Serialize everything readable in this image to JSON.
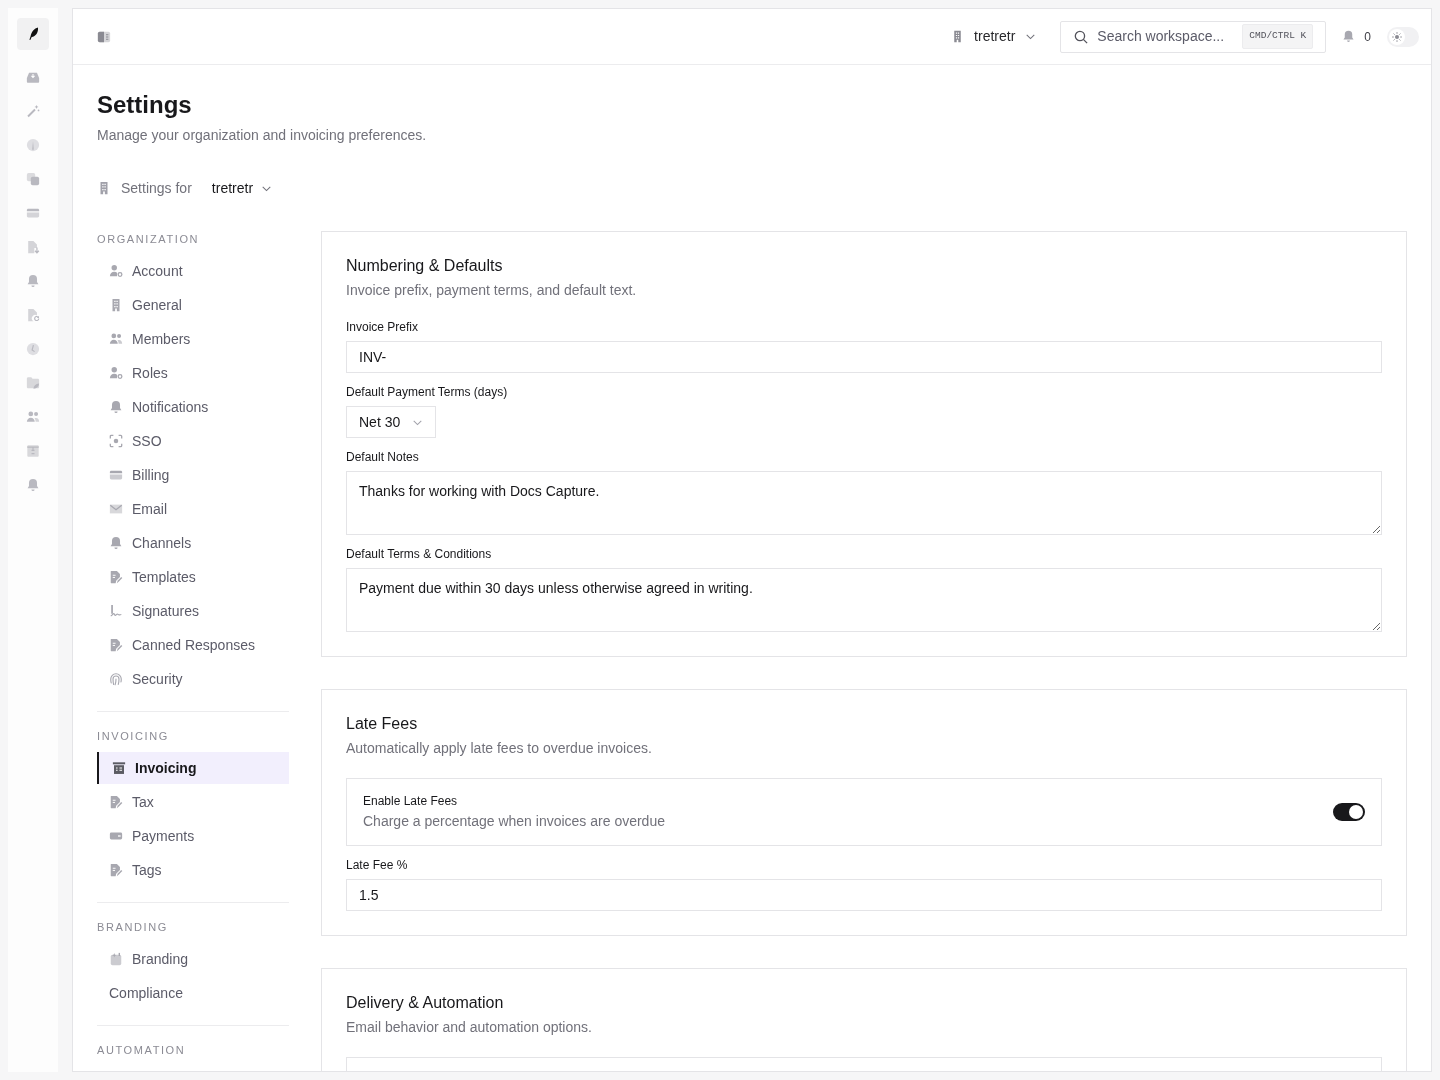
{
  "topbar": {
    "workspace": "tretretr",
    "search": {
      "placeholder": "Search workspace...",
      "shortcut": "CMD/CTRL K"
    },
    "notifications": {
      "count": "0"
    },
    "theme_switch": {
      "on": false
    }
  },
  "page": {
    "title": "Settings",
    "subtitle": "Manage your organization and invoicing preferences.",
    "scope": {
      "label": "Settings for",
      "value": "tretretr"
    }
  },
  "nav": [
    {
      "heading": "ORGANIZATION",
      "items": [
        {
          "label": "Account",
          "selected": false
        },
        {
          "label": "General",
          "selected": false
        },
        {
          "label": "Members",
          "selected": false
        },
        {
          "label": "Roles",
          "selected": false
        },
        {
          "label": "Notifications",
          "selected": false
        },
        {
          "label": "SSO",
          "selected": false
        },
        {
          "label": "Billing",
          "selected": false
        },
        {
          "label": "Email",
          "selected": false
        },
        {
          "label": "Channels",
          "selected": false
        },
        {
          "label": "Templates",
          "selected": false
        },
        {
          "label": "Signatures",
          "selected": false
        },
        {
          "label": "Canned Responses",
          "selected": false
        },
        {
          "label": "Security",
          "selected": false
        }
      ]
    },
    {
      "heading": "INVOICING",
      "items": [
        {
          "label": "Invoicing",
          "selected": true
        },
        {
          "label": "Tax",
          "selected": false
        },
        {
          "label": "Payments",
          "selected": false
        },
        {
          "label": "Tags",
          "selected": false
        }
      ]
    },
    {
      "heading": "BRANDING",
      "items": [
        {
          "label": "Branding",
          "selected": false
        },
        {
          "label": "Compliance",
          "selected": false
        }
      ]
    },
    {
      "heading": "AUTOMATION"
    }
  ],
  "cards": [
    {
      "title": "Numbering & Defaults",
      "description": "Invoice prefix, payment terms, and default text.",
      "fields": [
        {
          "kind": "input",
          "label": "Invoice Prefix",
          "value": "INV-"
        },
        {
          "kind": "select",
          "label": "Default Payment Terms (days)",
          "value": "Net 30"
        },
        {
          "kind": "textarea",
          "label": "Default Notes",
          "value": "Thanks for working with Docs Capture."
        },
        {
          "kind": "textarea",
          "label": "Default Terms & Conditions",
          "value": "Payment due within 30 days unless otherwise agreed in writing."
        }
      ]
    },
    {
      "title": "Late Fees",
      "description": "Automatically apply late fees to overdue invoices.",
      "fields": [
        {
          "kind": "switch",
          "label": "Enable Late Fees",
          "description": "Charge a percentage when invoices are overdue",
          "on": true
        },
        {
          "kind": "input",
          "label": "Late Fee %",
          "value": "1.5"
        }
      ]
    },
    {
      "title": "Delivery & Automation",
      "description": "Email behavior and automation options.",
      "fields": [
        {
          "kind": "box"
        }
      ]
    }
  ]
}
